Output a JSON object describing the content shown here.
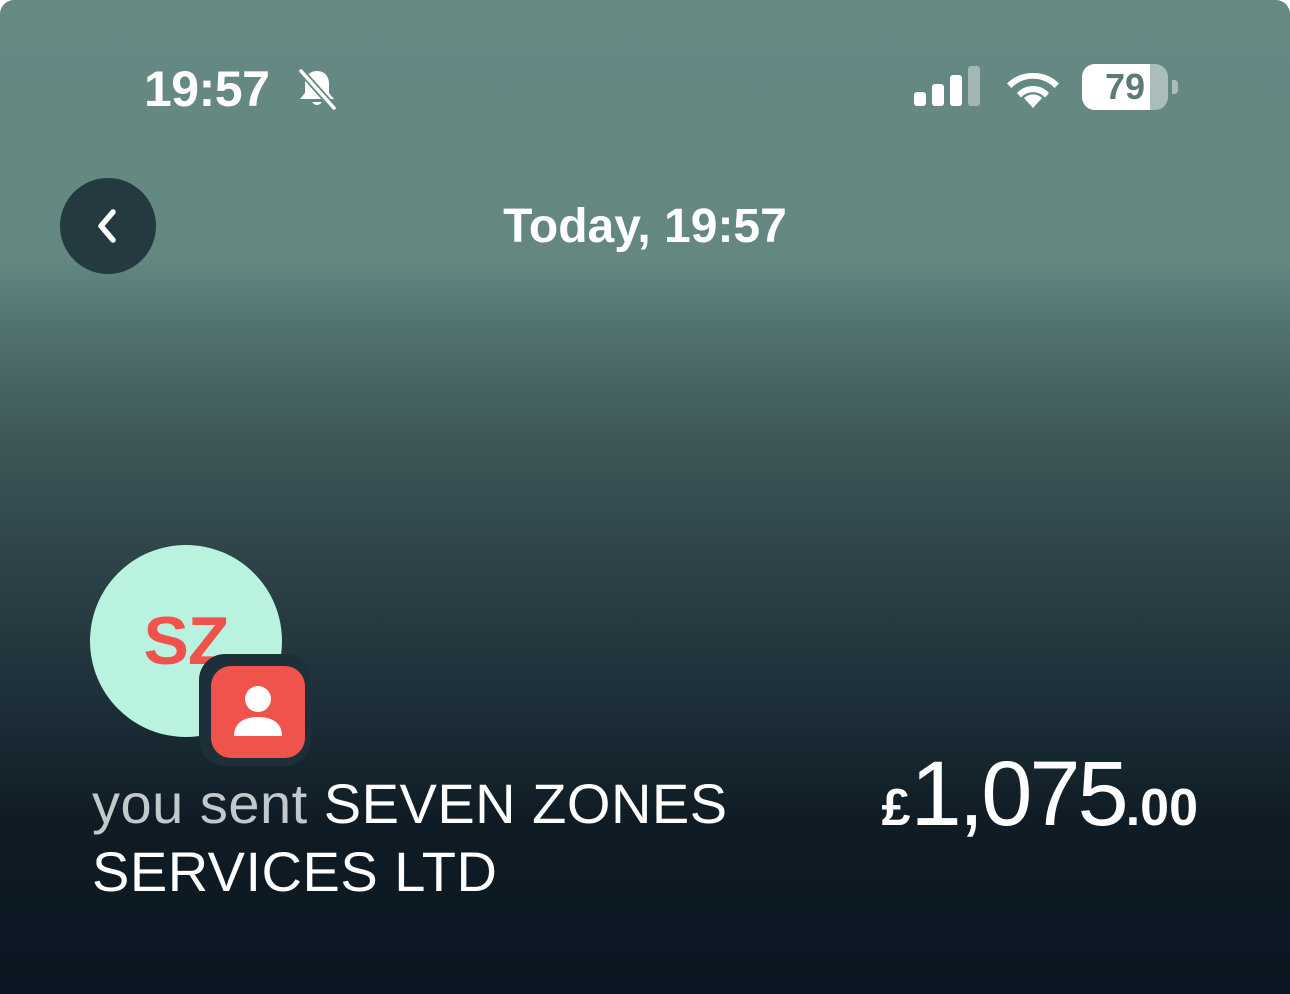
{
  "status_bar": {
    "time": "19:57",
    "battery_level": "79",
    "battery_fraction": 0.79,
    "icons": [
      "bell-slash-icon",
      "cellular-signal-icon",
      "wifi-icon",
      "battery-icon"
    ]
  },
  "nav": {
    "title": "Today, 19:57",
    "back_icon": "chevron-left-icon"
  },
  "payee": {
    "initials": "SZ",
    "badge_icon": "person-icon",
    "prefix": "you sent",
    "name": "SEVEN ZONES SERVICES LTD"
  },
  "amount": {
    "currency": "£",
    "main": "1,075",
    "minor": ".00"
  },
  "colors": {
    "avatar_bg": "#b9f3e0",
    "accent_red": "#f0524c",
    "back_button_bg": "#243a40"
  }
}
